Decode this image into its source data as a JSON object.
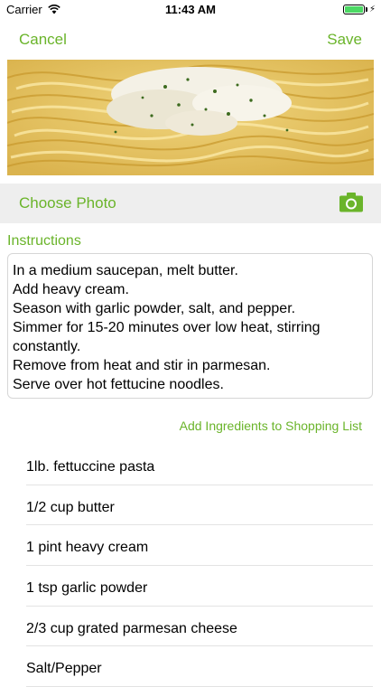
{
  "status_bar": {
    "carrier": "Carrier",
    "time": "11:43 AM",
    "battery_percent": 100,
    "battery_color": "#4cd964"
  },
  "nav": {
    "cancel_label": "Cancel",
    "save_label": "Save"
  },
  "photo": {
    "icon": "fettuccine-photo"
  },
  "choose_photo": {
    "label": "Choose Photo",
    "icon": "camera-icon"
  },
  "instructions": {
    "label": "Instructions",
    "lines": [
      "In a medium saucepan, melt butter.",
      "Add heavy cream.",
      "Season with garlic powder, salt, and pepper.",
      "Simmer for 15-20 minutes over low heat, stirring",
      "constantly.",
      "Remove from heat and stir in parmesan.",
      "Serve over hot fettucine noodles."
    ]
  },
  "shopping": {
    "add_label": "Add Ingredients to Shopping List"
  },
  "ingredients": [
    "1lb. fettuccine pasta",
    "1/2 cup butter",
    "1 pint heavy cream",
    "1 tsp garlic powder",
    "2/3 cup grated parmesan cheese",
    "Salt/Pepper"
  ],
  "accent_color": "#6ab42a"
}
